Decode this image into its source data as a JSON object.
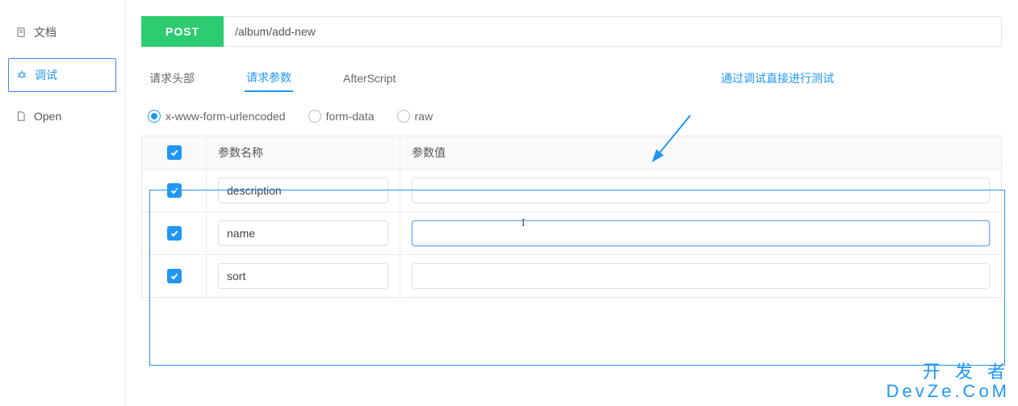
{
  "sidebar": {
    "items": [
      {
        "label": "文档",
        "icon": "file-icon"
      },
      {
        "label": "调试",
        "icon": "bug-icon",
        "active": true
      },
      {
        "label": "Open",
        "icon": "page-icon"
      }
    ]
  },
  "request": {
    "method": "POST",
    "url": "/album/add-new"
  },
  "tabs": {
    "items": [
      {
        "label": "请求头部"
      },
      {
        "label": "请求参数",
        "active": true
      },
      {
        "label": "AfterScript"
      }
    ]
  },
  "annotation": "通过调试直接进行测试",
  "content_type": {
    "options": [
      {
        "label": "x-www-form-urlencoded",
        "checked": true
      },
      {
        "label": "form-data",
        "checked": false
      },
      {
        "label": "raw",
        "checked": false
      }
    ]
  },
  "table": {
    "headers": {
      "name": "参数名称",
      "value": "参数值"
    },
    "rows": [
      {
        "checked": true,
        "name": "description",
        "value": ""
      },
      {
        "checked": true,
        "name": "name",
        "value": "",
        "focused": true
      },
      {
        "checked": true,
        "name": "sort",
        "value": ""
      }
    ]
  },
  "watermark": {
    "line1": "开 发 者",
    "line2": "DevZe.CoM"
  }
}
